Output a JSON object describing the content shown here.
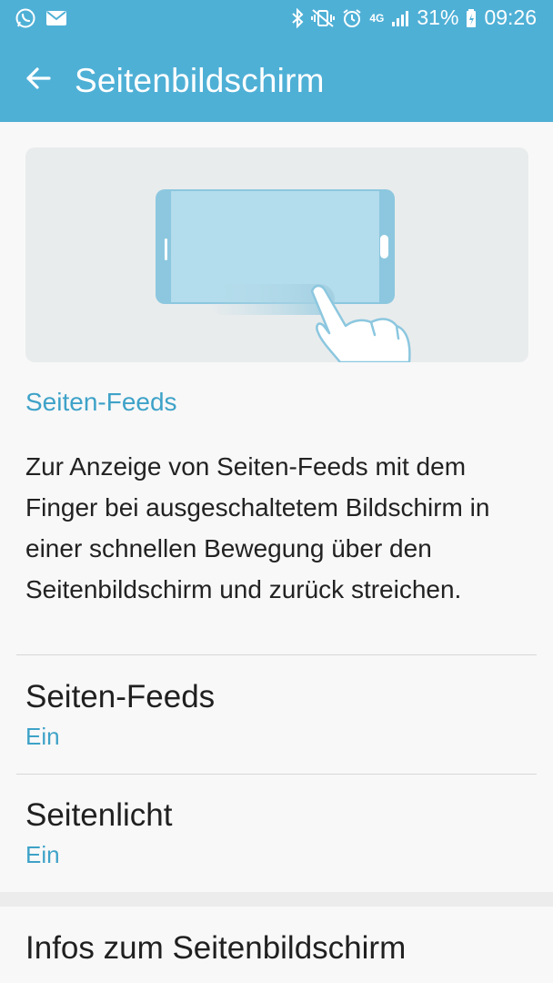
{
  "status_bar": {
    "icons_left": [
      "whatsapp-icon",
      "mail-icon"
    ],
    "icons_right": [
      "bluetooth-icon",
      "vibrate-mute-icon",
      "alarm-icon",
      "4g-icon",
      "signal-icon"
    ],
    "network": "4G",
    "battery_percent": "31%",
    "time": "09:26"
  },
  "app_bar": {
    "title": "Seitenbildschirm",
    "back_icon": "arrow-left-icon"
  },
  "colors": {
    "accent": "#4fb0d6",
    "link": "#3ea2c8"
  },
  "main": {
    "section_header": "Seiten-Feeds",
    "description": "Zur Anzeige von Seiten-Feeds mit dem Finger bei ausgeschaltetem Bildschirm in einer schnellen Bewegung über den Seitenbildschirm und zurück streichen.",
    "settings": [
      {
        "title": "Seiten-Feeds",
        "value": "Ein"
      },
      {
        "title": "Seitenlicht",
        "value": "Ein"
      }
    ],
    "info": {
      "title": "Infos zum Seitenbildschirm"
    }
  }
}
